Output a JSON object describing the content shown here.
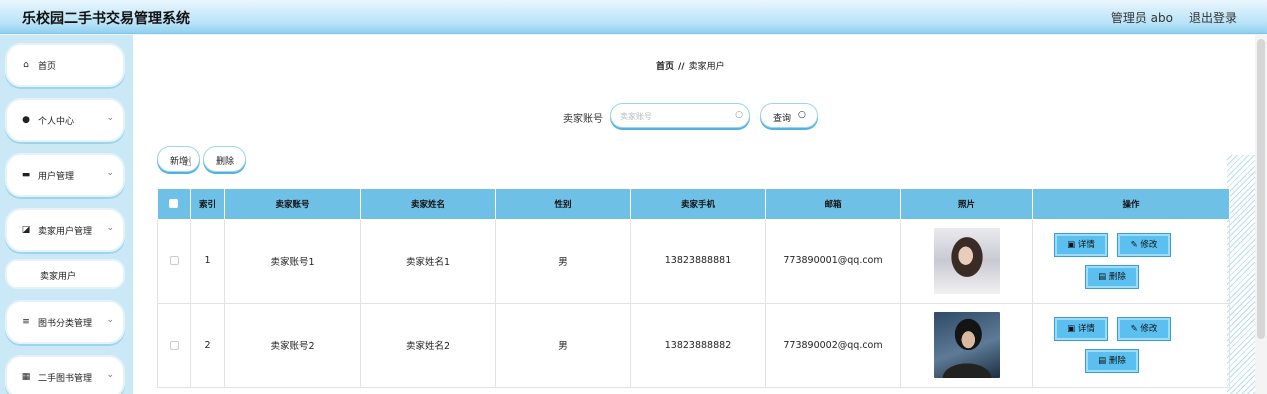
{
  "header": {
    "title": "乐校园二手书交易管理系统",
    "admin_label": "管理员 abo",
    "logout_label": "退出登录"
  },
  "sidebar": {
    "items": [
      {
        "label": "首页",
        "icon": "home-icon",
        "glyph": "⌂"
      },
      {
        "label": "个人中心",
        "icon": "user-icon",
        "glyph": "●"
      },
      {
        "label": "用户管理",
        "icon": "monitor-icon",
        "glyph": "▬"
      },
      {
        "label": "卖家用户管理",
        "icon": "edit-icon",
        "glyph": "◪"
      },
      {
        "label": "图书分类管理",
        "icon": "list-icon",
        "glyph": "≡"
      },
      {
        "label": "二手图书管理",
        "icon": "grid-icon",
        "glyph": "▦"
      }
    ],
    "sub_item": "卖家用户",
    "arrow": "⌄"
  },
  "breadcrumb": {
    "home": "首页",
    "separator": "//",
    "current": "卖家用户"
  },
  "search": {
    "label": "卖家账号",
    "placeholder": "卖家账号",
    "query_label": "查询",
    "search_glyph": "○"
  },
  "actions": {
    "add_label": "新增",
    "delete_label": "删除"
  },
  "table": {
    "headers": [
      "索引",
      "卖家账号",
      "卖家姓名",
      "性别",
      "卖家手机",
      "邮箱",
      "照片",
      "操作"
    ],
    "rows": [
      {
        "index": "1",
        "account": "卖家账号1",
        "name": "卖家姓名1",
        "gender": "男",
        "phone": "13823888881",
        "email": "773890001@qq.com"
      },
      {
        "index": "2",
        "account": "卖家账号2",
        "name": "卖家姓名2",
        "gender": "男",
        "phone": "13823888882",
        "email": "773890002@qq.com"
      }
    ],
    "row_actions": {
      "detail": "▣ 详情",
      "edit": "✎ 修改",
      "delete": "▤ 删除"
    }
  },
  "colors": {
    "accent": "#6fc0e6",
    "button": "#5bc0f0",
    "sidebar_bg": "#cbe8f7"
  }
}
